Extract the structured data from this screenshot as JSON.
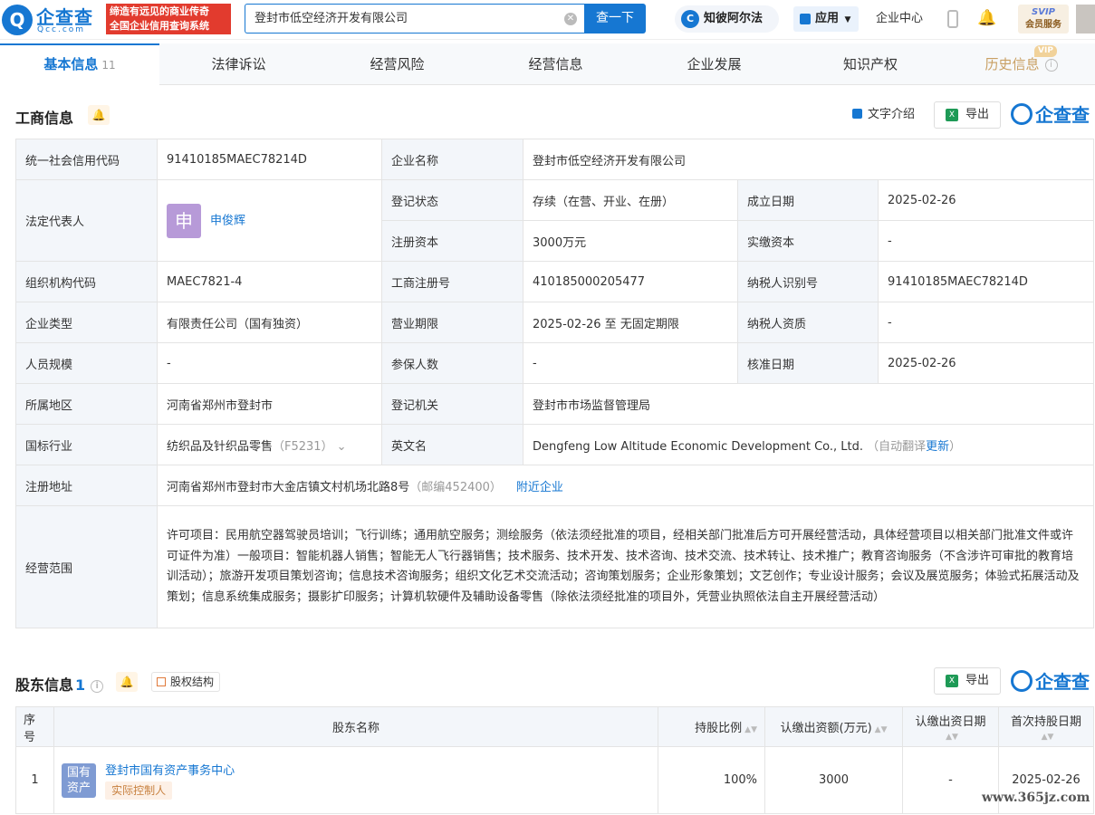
{
  "topbar": {
    "logo_name": "企查查",
    "logo_domain": "Qcc.com",
    "slogan_line1": "缔造有远见的商业传奇",
    "slogan_line2": "全国企业信用查询系统",
    "search_value": "登封市低空经济开发有限公司",
    "search_button": "查一下",
    "zhibi_label": "知彼阿尔法",
    "apps_label": "应用",
    "enterprise_center": "企业中心",
    "svip_label": "SVIP",
    "svip_sub": "会员服务"
  },
  "tabs": [
    {
      "label": "基本信息",
      "count": "11"
    },
    {
      "label": "法律诉讼"
    },
    {
      "label": "经营风险"
    },
    {
      "label": "经营信息"
    },
    {
      "label": "企业发展"
    },
    {
      "label": "知识产权"
    },
    {
      "label": "历史信息",
      "badge": "VIP"
    }
  ],
  "business_info": {
    "title": "工商信息",
    "text_intro": "文字介绍",
    "export": "导出",
    "brand": "企查查",
    "rows": {
      "credit_code_k": "统一社会信用代码",
      "credit_code_v": "91410185MAEC78214D",
      "company_name_k": "企业名称",
      "company_name_v": "登封市低空经济开发有限公司",
      "legal_rep_k": "法定代表人",
      "legal_rep_avatar": "申",
      "legal_rep_v": "申俊辉",
      "reg_status_k": "登记状态",
      "reg_status_v": "存续（在营、开业、在册）",
      "est_date_k": "成立日期",
      "est_date_v": "2025-02-26",
      "reg_capital_k": "注册资本",
      "reg_capital_v": "3000万元",
      "paid_capital_k": "实缴资本",
      "paid_capital_v": "-",
      "org_code_k": "组织机构代码",
      "org_code_v": "MAEC7821-4",
      "biz_reg_no_k": "工商注册号",
      "biz_reg_no_v": "410185000205477",
      "taxpayer_id_k": "纳税人识别号",
      "taxpayer_id_v": "91410185MAEC78214D",
      "company_type_k": "企业类型",
      "company_type_v": "有限责任公司（国有独资）",
      "biz_term_k": "营业期限",
      "biz_term_v": "2025-02-26 至 无固定期限",
      "taxpayer_qual_k": "纳税人资质",
      "taxpayer_qual_v": "-",
      "staff_size_k": "人员规模",
      "staff_size_v": "-",
      "insured_k": "参保人数",
      "insured_v": "-",
      "approval_date_k": "核准日期",
      "approval_date_v": "2025-02-26",
      "region_k": "所属地区",
      "region_v": "河南省郑州市登封市",
      "reg_authority_k": "登记机关",
      "reg_authority_v": "登封市市场监督管理局",
      "industry_k": "国标行业",
      "industry_v": "纺织品及针织品零售",
      "industry_code": "（F5231）",
      "english_name_k": "英文名",
      "english_name_v": "Dengfeng Low Altitude Economic Development Co., Ltd.",
      "auto_translate": "（自动翻译",
      "update_link": "更新",
      "close_paren": "）",
      "address_k": "注册地址",
      "address_v": "河南省郑州市登封市大金店镇文村机场北路8号",
      "postcode": "（邮编452400）",
      "nearby_link": "附近企业",
      "scope_k": "经营范围",
      "scope_v": "许可项目：民用航空器驾驶员培训；飞行训练；通用航空服务；测绘服务（依法须经批准的项目，经相关部门批准后方可开展经营活动，具体经营项目以相关部门批准文件或许可证件为准）一般项目：智能机器人销售；智能无人飞行器销售；技术服务、技术开发、技术咨询、技术交流、技术转让、技术推广；教育咨询服务（不含涉许可审批的教育培训活动）；旅游开发项目策划咨询；信息技术咨询服务；组织文化艺术交流活动；咨询策划服务；企业形象策划；文艺创作；专业设计服务；会议及展览服务；体验式拓展活动及策划；信息系统集成服务；摄影扩印服务；计算机软硬件及辅助设备零售（除依法须经批准的项目外，凭营业执照依法自主开展经营活动）"
    }
  },
  "shareholders": {
    "title": "股东信息",
    "count": "1",
    "equity_structure": "股权结构",
    "export": "导出",
    "brand": "企查查",
    "headers": [
      "序号",
      "股东名称",
      "持股比例",
      "认缴出资额(万元)",
      "认缴出资日期",
      "首次持股日期"
    ],
    "rows": [
      {
        "no": "1",
        "badge": "国有资产",
        "badge_l1": "国有",
        "badge_l2": "资产",
        "name": "登封市国有资产事务中心",
        "tag": "实际控制人",
        "ratio": "100%",
        "amount": "3000",
        "date": "-",
        "first_date": "2025-02-26"
      }
    ]
  },
  "watermark": "www.365jz.com"
}
